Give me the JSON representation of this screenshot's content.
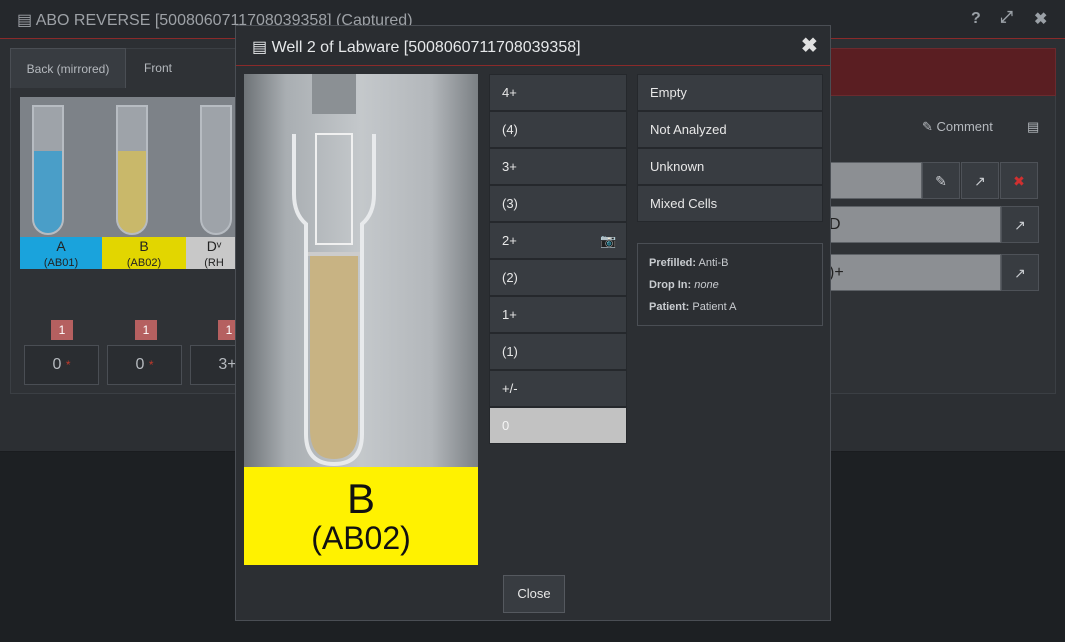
{
  "background": {
    "title": "ABO REVERSE [5008060711708039358]  (Captured)",
    "tabs": [
      "Back (mirrored)",
      "Front"
    ],
    "strip_labels": [
      {
        "name": "A",
        "sub": "(AB01)",
        "color": "#1aa3dc"
      },
      {
        "name": "B",
        "sub": "(AB02)",
        "color": "#e2d600"
      },
      {
        "name": "Dᵛ",
        "sub": "(RH",
        "color": "#c8c8c8"
      }
    ],
    "badges": [
      "1",
      "1",
      "1"
    ],
    "values": [
      "0",
      "0",
      "3+"
    ],
    "comment_label": "Comment",
    "field_values": [
      "D",
      ")+"
    ]
  },
  "modal": {
    "title": "Well 2 of Labware [5008060711708039358]",
    "image_label_main": "B",
    "image_label_sub": "(AB02)",
    "grades": [
      "4+",
      "(4)",
      "3+",
      "(3)",
      "2+",
      "(2)",
      "1+",
      "(1)",
      "+/-",
      "0"
    ],
    "selected_grade": "0",
    "options": [
      "Empty",
      "Not Analyzed",
      "Unknown",
      "Mixed Cells"
    ],
    "info": {
      "prefilled_label": "Prefilled:",
      "prefilled_value": "Anti-B",
      "dropin_label": "Drop In:",
      "dropin_value": "none",
      "patient_label": "Patient:",
      "patient_value": "Patient A"
    },
    "close_label": "Close"
  },
  "colors": {
    "accent_red": "#8a2a2a",
    "label_yellow": "#fff200",
    "selected_grade": "#c2c2c2"
  }
}
